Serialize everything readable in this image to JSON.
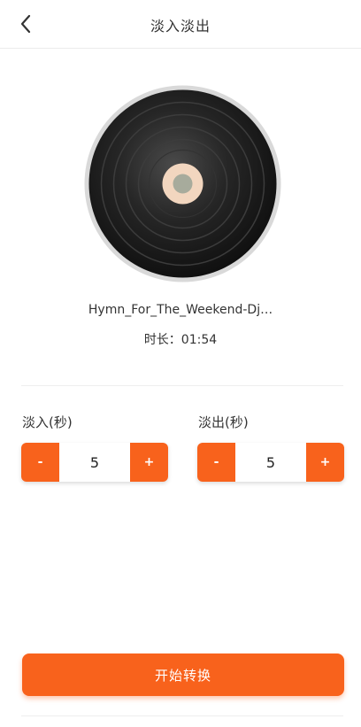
{
  "header": {
    "title": "淡入淡出",
    "back_icon": "chevron-left-icon"
  },
  "track": {
    "title": "Hymn_For_The_Weekend-Dj…",
    "duration": "时长：01:54"
  },
  "fade_in": {
    "label": "淡入(秒)",
    "value": "5",
    "minus": "-",
    "plus": "+"
  },
  "fade_out": {
    "label": "淡出(秒)",
    "value": "5",
    "minus": "-",
    "plus": "+"
  },
  "actions": {
    "convert_label": "开始转换"
  },
  "colors": {
    "accent": "#f8621c",
    "disc": "#1f1f1f",
    "disc_label": "#f2d6bf"
  }
}
